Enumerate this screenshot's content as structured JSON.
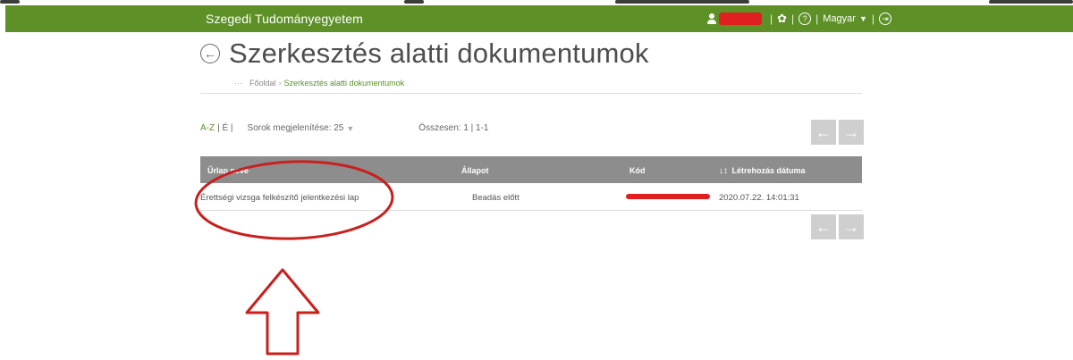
{
  "topbar": {
    "brand": "Szegedi Tudományegyetem",
    "separator": "|",
    "language": "Magyar",
    "help_glyph": "?",
    "logout_glyph": "⇥",
    "colors": {
      "bar": "#5d9127"
    }
  },
  "page": {
    "title": "Szerkesztés alatti dokumentumok",
    "back_glyph": "←"
  },
  "breadcrumb": {
    "dots": "···",
    "home": "Főoldal",
    "separator": "›",
    "current": "Szerkesztés alatti dokumentumok"
  },
  "toolbar": {
    "sort_az": "A-Z",
    "sort_ae": "| É |",
    "rows_label": "Sorok megjelenítése: 25",
    "rows_caret": "▼",
    "total": "Összesen: 1 | 1-1"
  },
  "pager": {
    "prev": "←",
    "next": "→"
  },
  "table": {
    "columns": {
      "name": "Űrlap neve",
      "status": "Állapot",
      "code": "Kód",
      "sort_arrows": "↓↕",
      "created": "Létrehozás dátuma"
    },
    "rows": [
      {
        "name": "Érettségi vizsga felkészítő jelentkezési lap",
        "status": "Beadás előtt",
        "created": "2020.07.22. 14:01:31"
      }
    ]
  },
  "annotation_colors": {
    "circle": "#c8201e",
    "arrow": "#c8201e"
  }
}
